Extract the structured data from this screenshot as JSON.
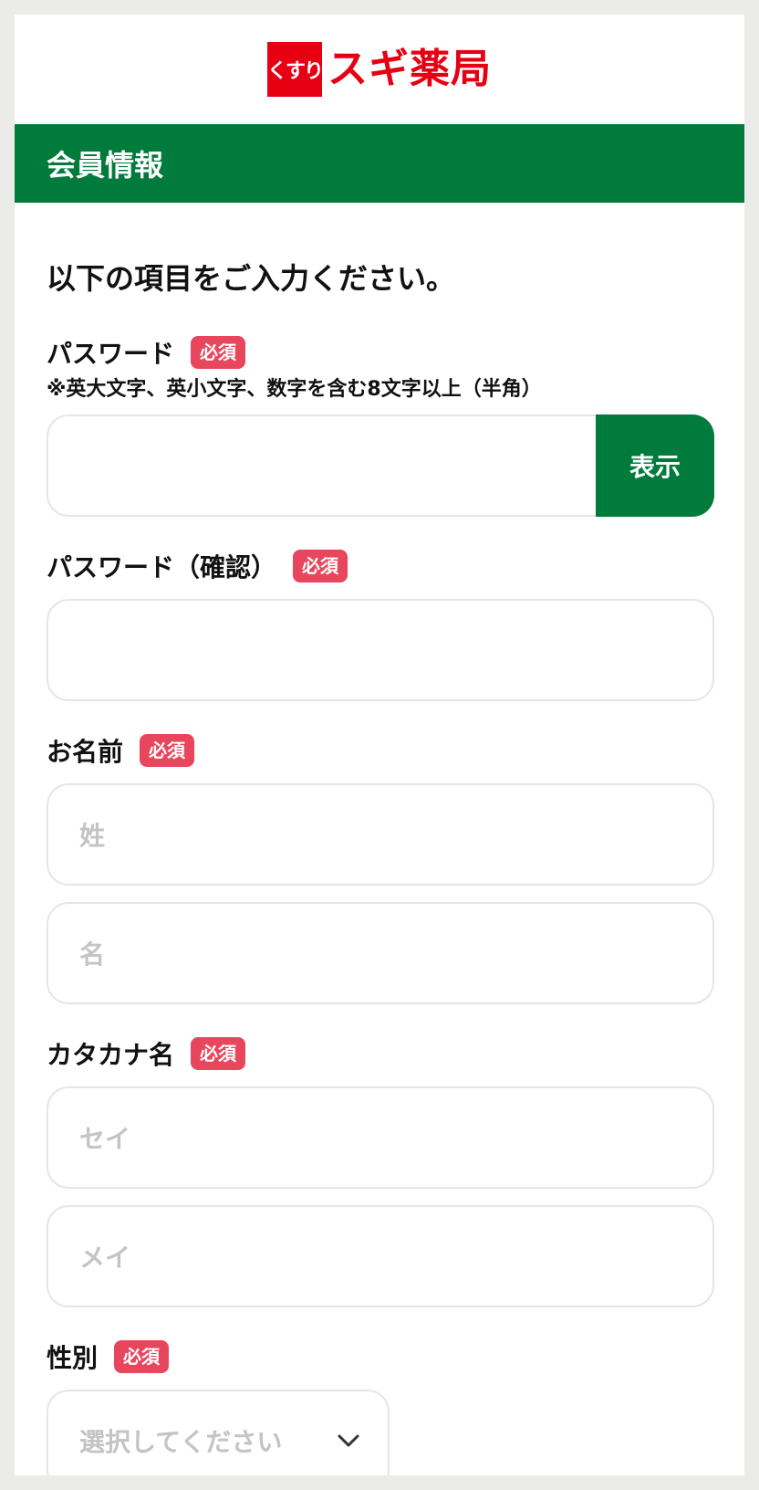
{
  "logo": {
    "box_text": "くすり",
    "brand_text": "スギ薬局",
    "brand_color": "#e60012"
  },
  "section": {
    "title": "会員情報",
    "color": "#007b3c"
  },
  "intro": "以下の項目をご入力ください。",
  "required_badge": "必須",
  "password": {
    "label": "パスワード",
    "note": "※英大文字、英小文字、数字を含む8文字以上（半角）",
    "value": "",
    "show_button": "表示"
  },
  "password_confirm": {
    "label": "パスワード（確認）",
    "value": ""
  },
  "name": {
    "label": "お名前",
    "last_placeholder": "姓",
    "first_placeholder": "名"
  },
  "kana": {
    "label": "カタカナ名",
    "last_placeholder": "セイ",
    "first_placeholder": "メイ"
  },
  "gender": {
    "label": "性別",
    "placeholder": "選択してください"
  },
  "icons": {
    "select_arrow": "chevron-down-icon"
  },
  "colors": {
    "badge": "#e8465c",
    "placeholder": "#c4c4c4"
  }
}
